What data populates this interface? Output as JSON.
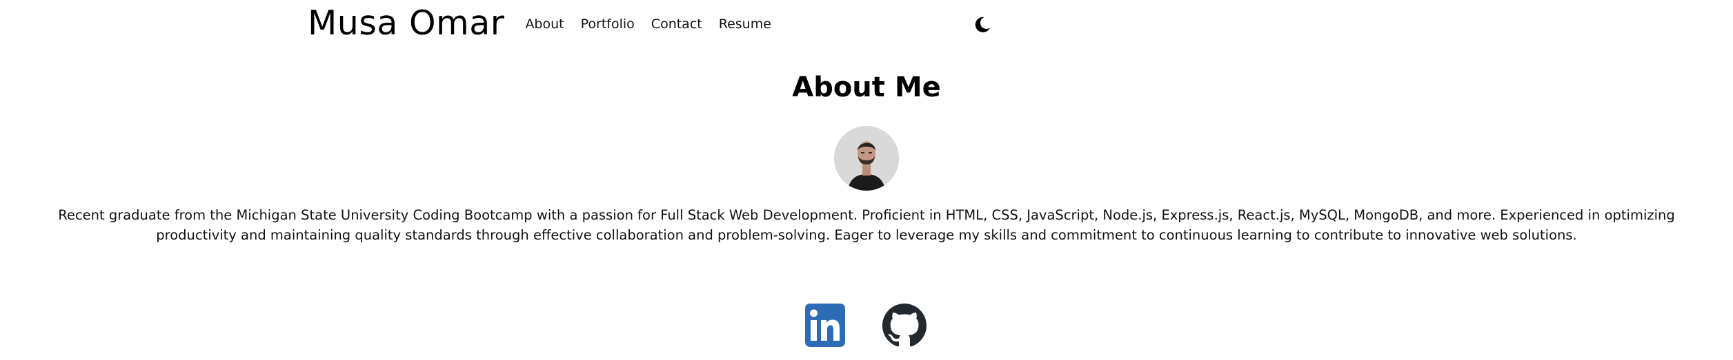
{
  "header": {
    "brand": "Musa Omar",
    "nav": {
      "about": "About",
      "portfolio": "Portfolio",
      "contact": "Contact",
      "resume": "Resume"
    },
    "theme_toggle_icon": "moon-icon"
  },
  "about": {
    "title": "About Me",
    "bio": "Recent graduate from the Michigan State University Coding Bootcamp with a passion for Full Stack Web Development. Proficient in HTML, CSS, JavaScript, Node.js, Express.js, React.js, MySQL, MongoDB, and more. Experienced in optimizing productivity and maintaining quality standards through effective collaboration and problem-solving. Eager to leverage my skills and commitment to continuous learning to contribute to innovative web solutions."
  },
  "social": {
    "linkedin_icon": "linkedin-icon",
    "github_icon": "github-icon"
  },
  "colors": {
    "linkedin_blue": "#2d6bb5",
    "github_dark": "#24292e",
    "avatar_bg": "#d9d9d9"
  }
}
